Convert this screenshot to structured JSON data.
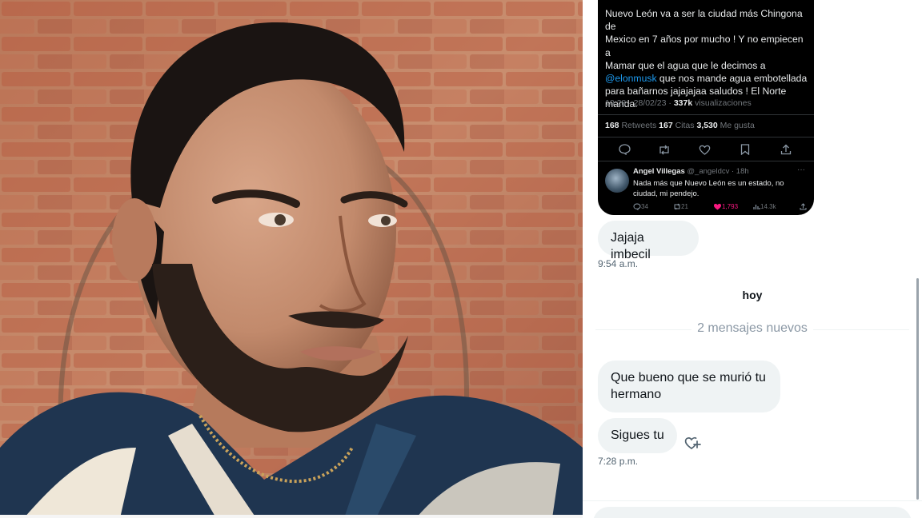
{
  "photo": {
    "alt_subject": "portrait-photo"
  },
  "tweet": {
    "text_lines": [
      "Nuevo León va a ser la ciudad más Chingona de",
      "Mexico en 7 años por mucho ! Y no empiecen a",
      "Mamar que el agua que le decimos a",
      "@elonmusk",
      " que nos mande agua embotellada",
      "para bañarnos jajajajaa saludos ! El Norte",
      "manda."
    ],
    "meta_time": "10:28 · 28/02/23 · ",
    "views_count": "337k",
    "views_label": " visualizaciones",
    "retweets_count": "168",
    "retweets_label": " Retweets  ",
    "quotes_count": "167",
    "quotes_label": " Citas  ",
    "likes_count": "3,530",
    "likes_label": " Me gusta",
    "reply": {
      "name": "Angel Villegas",
      "handle": " @_angeldcv · 18h",
      "more": "···",
      "body": "Nada más que Nuevo León es un estado, no ciudad, mi pendejo.",
      "replies": "34",
      "retweets": "21",
      "likes": "1,793",
      "views": "14.3k"
    },
    "colors": {
      "background": "#000000",
      "link": "#1d9bf0",
      "like": "#f91880"
    }
  },
  "messages": [
    {
      "text": "Jajaja imbecil",
      "time": "9:54 a.m."
    },
    {
      "text": "Que bueno que se murió tu hermano"
    },
    {
      "text": "Sigues tu",
      "time": "7:28 p.m."
    }
  ],
  "day_separator": "hoy",
  "new_messages": "2 mensajes nuevos",
  "icons": [
    "reply-icon",
    "retweet-icon",
    "like-icon",
    "bookmark-icon",
    "share-icon",
    "add-reaction-icon"
  ]
}
